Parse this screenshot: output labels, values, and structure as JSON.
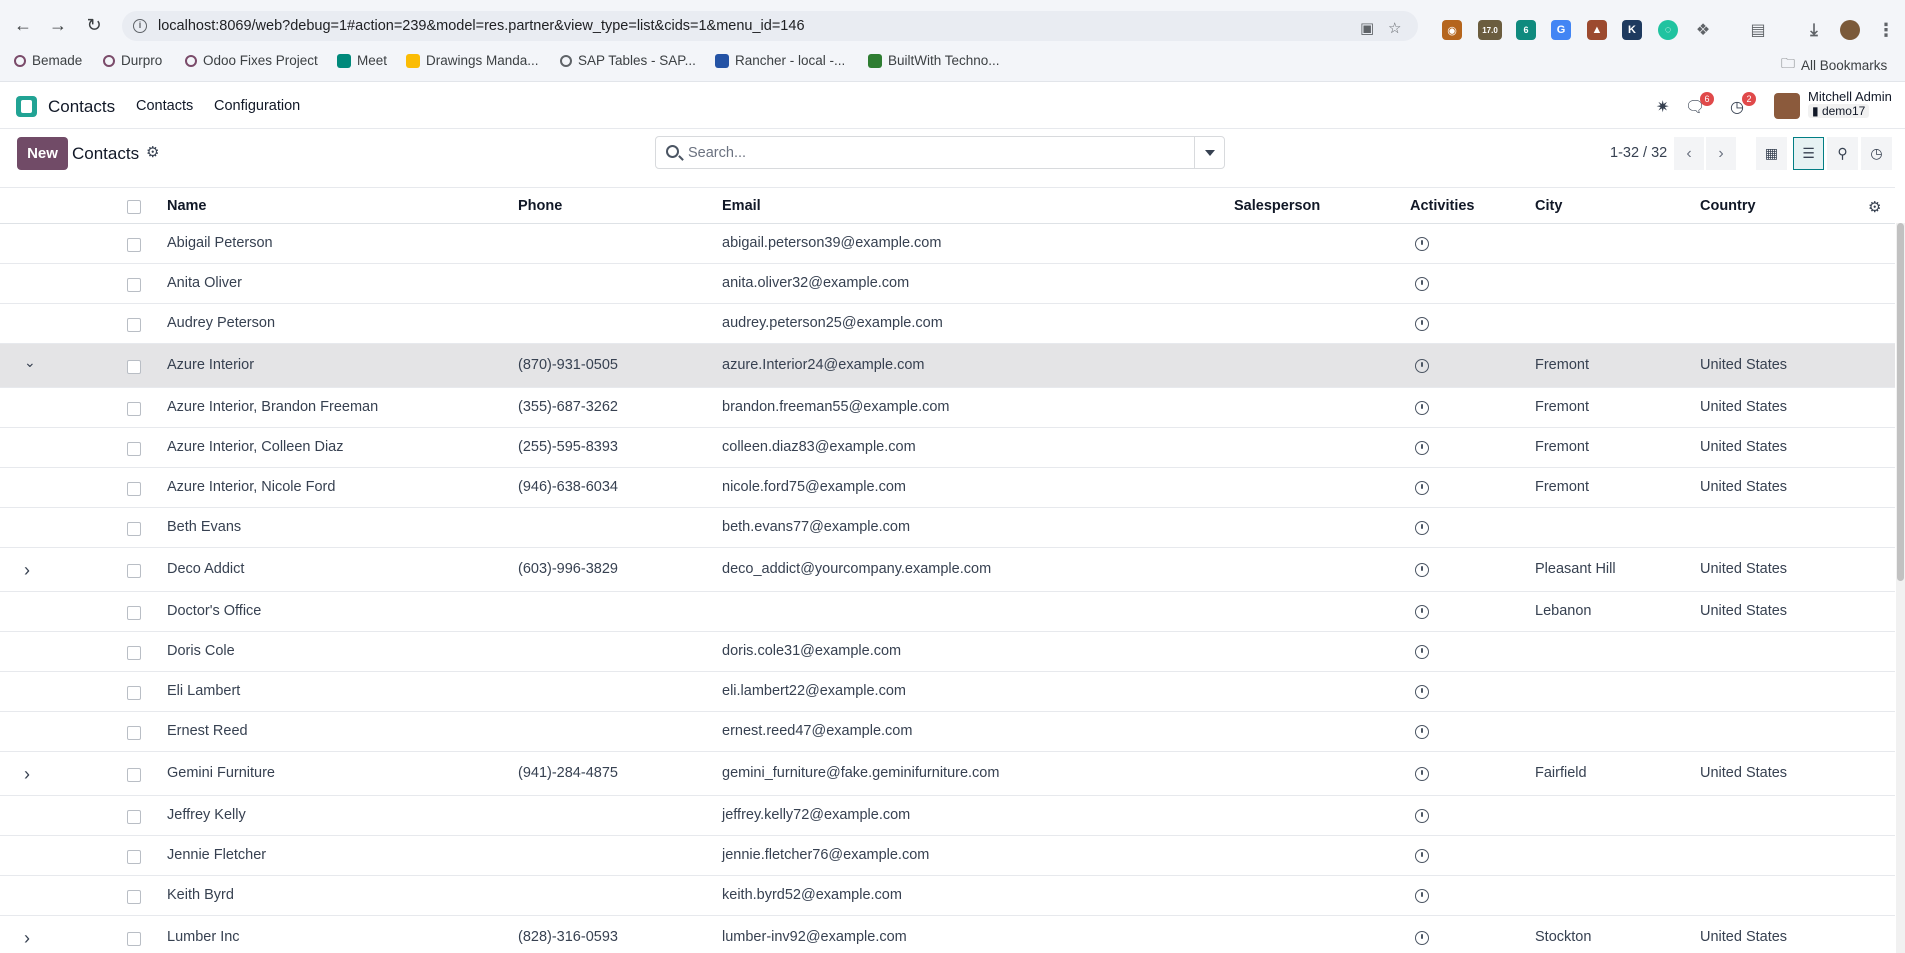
{
  "browser": {
    "url": "localhost:8069/web?debug=1#action=239&model=res.partner&view_type=list&cids=1&menu_id=146",
    "ext_badge_1": "17.0",
    "ext_badge_2": "6",
    "bookmarks": [
      "Bemade",
      "Durpro",
      "Odoo Fixes Project",
      "Meet",
      "Drawings Manda...",
      "SAP Tables - SAP...",
      "Rancher - local -...",
      "BuiltWith Techno..."
    ],
    "all_bookmarks": "All Bookmarks"
  },
  "navbar": {
    "app_name": "Contacts",
    "menus": [
      "Contacts",
      "Configuration"
    ],
    "messages_count": "6",
    "activities_count": "2",
    "user_name": "Mitchell Admin",
    "user_db": "demo17"
  },
  "control_panel": {
    "new_label": "New",
    "breadcrumb": "Contacts",
    "search_placeholder": "Search...",
    "pager": "1-32 / 32"
  },
  "list": {
    "columns": [
      "Name",
      "Phone",
      "Email",
      "Salesperson",
      "Activities",
      "City",
      "Country"
    ],
    "rows": [
      {
        "name": "Abigail Peterson",
        "phone": "",
        "email": "abigail.peterson39@example.com",
        "salesperson": "",
        "city": "",
        "country": ""
      },
      {
        "name": "Anita Oliver",
        "phone": "",
        "email": "anita.oliver32@example.com",
        "salesperson": "",
        "city": "",
        "country": ""
      },
      {
        "name": "Audrey Peterson",
        "phone": "",
        "email": "audrey.peterson25@example.com",
        "salesperson": "",
        "city": "",
        "country": ""
      },
      {
        "name": "Azure Interior",
        "phone": "(870)-931-0505",
        "email": "azure.Interior24@example.com",
        "salesperson": "",
        "city": "Fremont",
        "country": "United States"
      },
      {
        "name": "Azure Interior, Brandon Freeman",
        "phone": "(355)-687-3262",
        "email": "brandon.freeman55@example.com",
        "salesperson": "",
        "city": "Fremont",
        "country": "United States"
      },
      {
        "name": "Azure Interior, Colleen Diaz",
        "phone": "(255)-595-8393",
        "email": "colleen.diaz83@example.com",
        "salesperson": "",
        "city": "Fremont",
        "country": "United States"
      },
      {
        "name": "Azure Interior, Nicole Ford",
        "phone": "(946)-638-6034",
        "email": "nicole.ford75@example.com",
        "salesperson": "",
        "city": "Fremont",
        "country": "United States"
      },
      {
        "name": "Beth Evans",
        "phone": "",
        "email": "beth.evans77@example.com",
        "salesperson": "",
        "city": "",
        "country": ""
      },
      {
        "name": "Deco Addict",
        "phone": "(603)-996-3829",
        "email": "deco_addict@yourcompany.example.com",
        "salesperson": "",
        "city": "Pleasant Hill",
        "country": "United States"
      },
      {
        "name": "Doctor's Office",
        "phone": "",
        "email": "",
        "salesperson": "",
        "city": "Lebanon",
        "country": "United States"
      },
      {
        "name": "Doris Cole",
        "phone": "",
        "email": "doris.cole31@example.com",
        "salesperson": "",
        "city": "",
        "country": ""
      },
      {
        "name": "Eli Lambert",
        "phone": "",
        "email": "eli.lambert22@example.com",
        "salesperson": "",
        "city": "",
        "country": ""
      },
      {
        "name": "Ernest Reed",
        "phone": "",
        "email": "ernest.reed47@example.com",
        "salesperson": "",
        "city": "",
        "country": ""
      },
      {
        "name": "Gemini Furniture",
        "phone": "(941)-284-4875",
        "email": "gemini_furniture@fake.geminifurniture.com",
        "salesperson": "",
        "city": "Fairfield",
        "country": "United States"
      },
      {
        "name": "Jeffrey Kelly",
        "phone": "",
        "email": "jeffrey.kelly72@example.com",
        "salesperson": "",
        "city": "",
        "country": ""
      },
      {
        "name": "Jennie Fletcher",
        "phone": "",
        "email": "jennie.fletcher76@example.com",
        "salesperson": "",
        "city": "",
        "country": ""
      },
      {
        "name": "Keith Byrd",
        "phone": "",
        "email": "keith.byrd52@example.com",
        "salesperson": "",
        "city": "",
        "country": ""
      },
      {
        "name": "Lumber Inc",
        "phone": "(828)-316-0593",
        "email": "lumber-inv92@example.com",
        "salesperson": "",
        "city": "Stockton",
        "country": "United States"
      }
    ]
  },
  "colors": {
    "brand": "#714b67",
    "app_icon": "#21a394",
    "badge": "#e0494a",
    "selected_row": "#e4e4e6",
    "active_view": "#017e84"
  }
}
